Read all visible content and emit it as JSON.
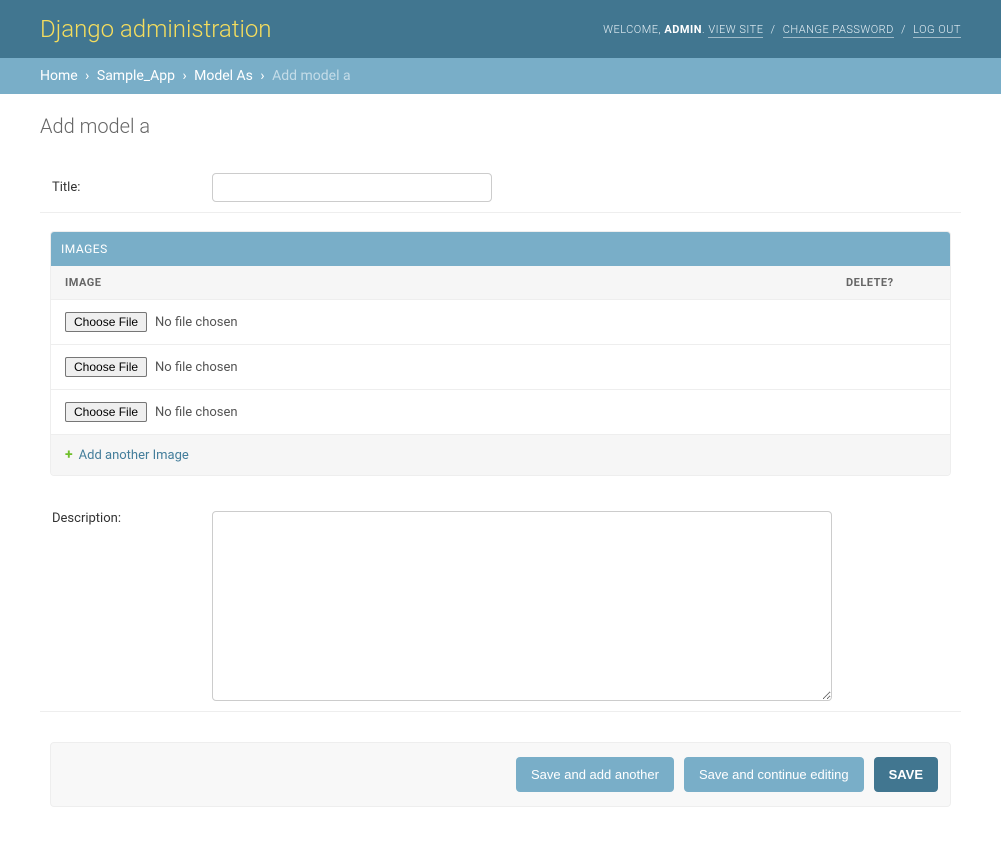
{
  "header": {
    "branding": "Django administration",
    "welcome": "WELCOME,",
    "username": "ADMIN",
    "view_site": "VIEW SITE",
    "change_password": "CHANGE PASSWORD",
    "logout": "LOG OUT"
  },
  "breadcrumbs": {
    "home": "Home",
    "app": "Sample_App",
    "model": "Model As",
    "current": "Add model a"
  },
  "page": {
    "title": "Add model a"
  },
  "form": {
    "title_label": "Title:",
    "title_value": "",
    "description_label": "Description:",
    "description_value": ""
  },
  "inline": {
    "heading": "IMAGES",
    "col_image": "IMAGE",
    "col_delete": "DELETE?",
    "rows": [
      {
        "choose": "Choose File",
        "status": "No file chosen"
      },
      {
        "choose": "Choose File",
        "status": "No file chosen"
      },
      {
        "choose": "Choose File",
        "status": "No file chosen"
      }
    ],
    "add_another": "Add another Image"
  },
  "submit": {
    "save_add_another": "Save and add another",
    "save_continue": "Save and continue editing",
    "save": "SAVE"
  }
}
